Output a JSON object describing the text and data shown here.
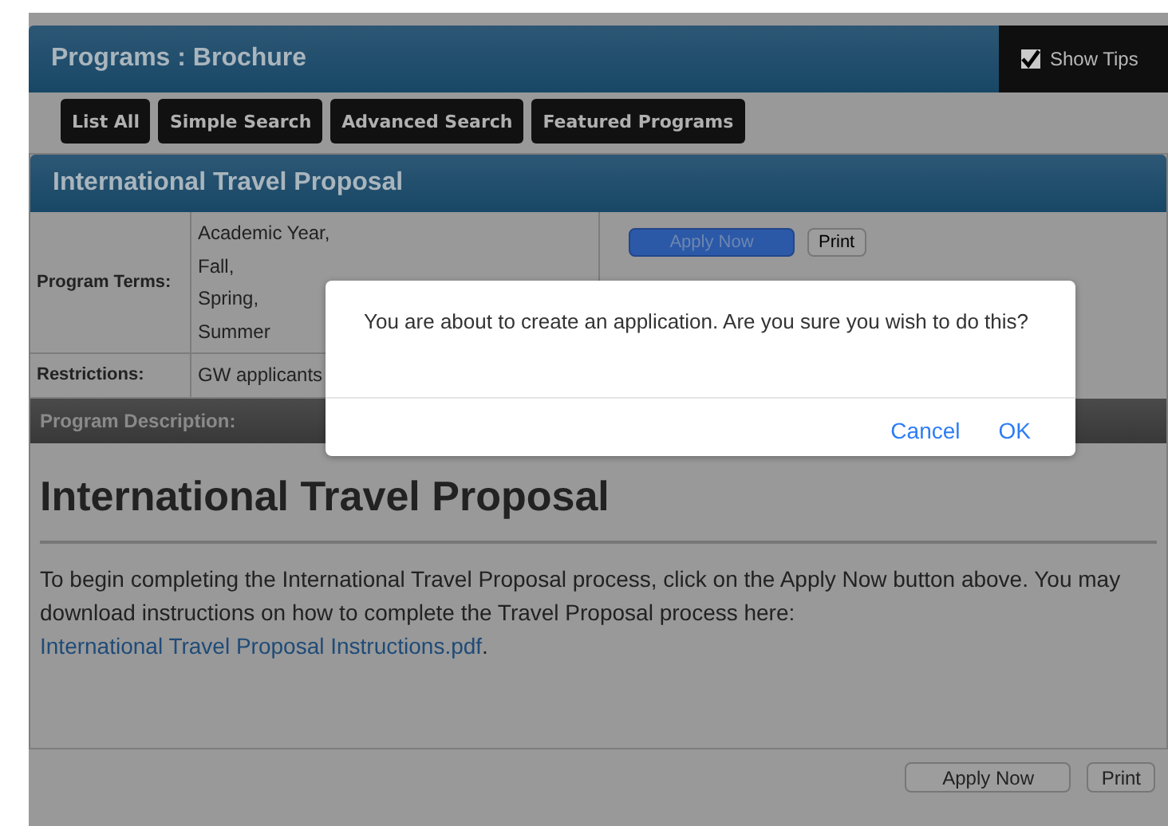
{
  "header": {
    "title": "Programs : Brochure",
    "show_tips": {
      "label": "Show Tips",
      "checked": true
    }
  },
  "nav": [
    "List All",
    "Simple Search",
    "Advanced Search",
    "Featured Programs"
  ],
  "program": {
    "title": "International Travel Proposal",
    "fields": [
      {
        "label": "Program Terms:",
        "values": [
          "Academic Year,",
          "Fall,",
          "Spring,",
          "Summer"
        ]
      },
      {
        "label": "Restrictions:",
        "values": [
          "GW applicants"
        ]
      }
    ],
    "top_buttons": [
      "Apply Now",
      "Print"
    ],
    "description_label": "Program Description:",
    "heading": "International Travel Proposal",
    "body": "To begin completing the International Travel Proposal process, click on the Apply Now button above.  You may download instructions on how to complete the Travel Proposal process here: ",
    "link": "International Travel Proposal Instructions.pdf",
    "body_end": ".",
    "bottom_buttons": [
      "Apply Now",
      "Print"
    ]
  },
  "dialog": {
    "message": "You are about to create an application.  Are you sure you wish to do this?",
    "buttons": [
      "Cancel",
      "OK"
    ]
  }
}
